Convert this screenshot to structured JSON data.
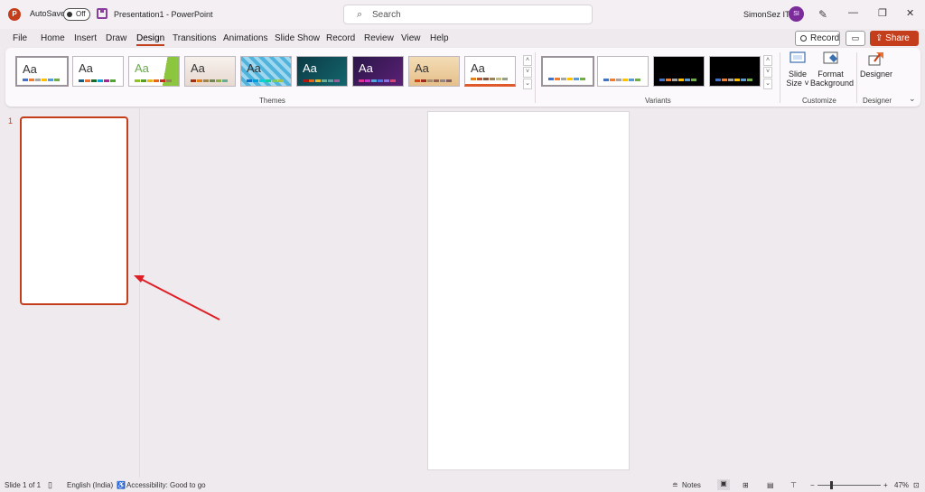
{
  "titlebar": {
    "app_icon": "powerpoint-logo",
    "app_icon_letter": "P",
    "autosave_label": "AutoSave",
    "autosave_state": "Off",
    "document_title": "Presentation1  -  PowerPoint",
    "search_placeholder": "Search",
    "user_name": "SimonSez IT",
    "user_initials": "SI",
    "window_controls": [
      "minimize-icon",
      "restore-icon",
      "close-icon"
    ],
    "min_glyph": "—",
    "restore_glyph": "❐",
    "close_glyph": "✕",
    "pen_glyph": "✎",
    "search_glyph": "⌕"
  },
  "menu": {
    "tabs": [
      "File",
      "Home",
      "Insert",
      "Draw",
      "Design",
      "Transitions",
      "Animations",
      "Slide Show",
      "Record",
      "Review",
      "View",
      "Help"
    ],
    "active_tab": "Design",
    "record_label": "Record",
    "share_label": "Share",
    "share_chevron": "⌄",
    "comment_glyph": "▭"
  },
  "ribbon": {
    "themes_label": "Themes",
    "theme_sample_text": "Aa",
    "variants_label": "Variants",
    "customize_label": "Customize",
    "designer_group_label": "Designer",
    "slide_size_label_1": "Slide",
    "slide_size_label_2": "Size ˅",
    "format_bg_label_1": "Format",
    "format_bg_label_2": "Background",
    "designer_btn_label": "Designer",
    "gallery_up": "˄",
    "gallery_down": "˅",
    "gallery_more": "⌄",
    "collapse_glyph": "⌄"
  },
  "slides": {
    "thumbnail_number": "1"
  },
  "status": {
    "slide_counter": "Slide 1 of 1",
    "language": "English (India)",
    "accessibility": "Accessibility: Good to go",
    "notes_label": "Notes",
    "zoom_minus": "−",
    "zoom_plus": "+",
    "zoom_level": "47%"
  },
  "colors": {
    "accent": "#c43e1c",
    "avatar": "#7b2c9a"
  }
}
